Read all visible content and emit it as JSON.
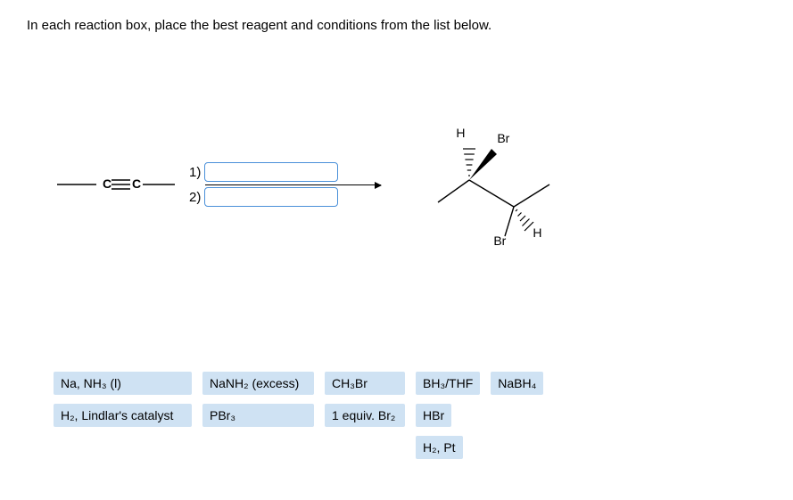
{
  "prompt": "In each reaction box, place the best reagent and conditions from the list below.",
  "steps": {
    "one": "1)",
    "two": "2)"
  },
  "product_labels": {
    "H_tl": "H",
    "Br_tr": "Br",
    "Br_bl": "Br",
    "H_br": "H"
  },
  "reagents": {
    "row1": {
      "na_nh3": "Na, NH₃ (l)",
      "nanh2": "NaNH₂ (excess)",
      "ch3br": "CH₃Br",
      "bh3thf": "BH₃/THF",
      "nabh4": "NaBH₄"
    },
    "row2": {
      "lindlar": "H₂, Lindlar's catalyst",
      "pbr3": "PBr₃",
      "br2": "1 equiv. Br₂",
      "hbr": "HBr"
    },
    "row3": {
      "h2pt": "H₂, Pt"
    }
  }
}
